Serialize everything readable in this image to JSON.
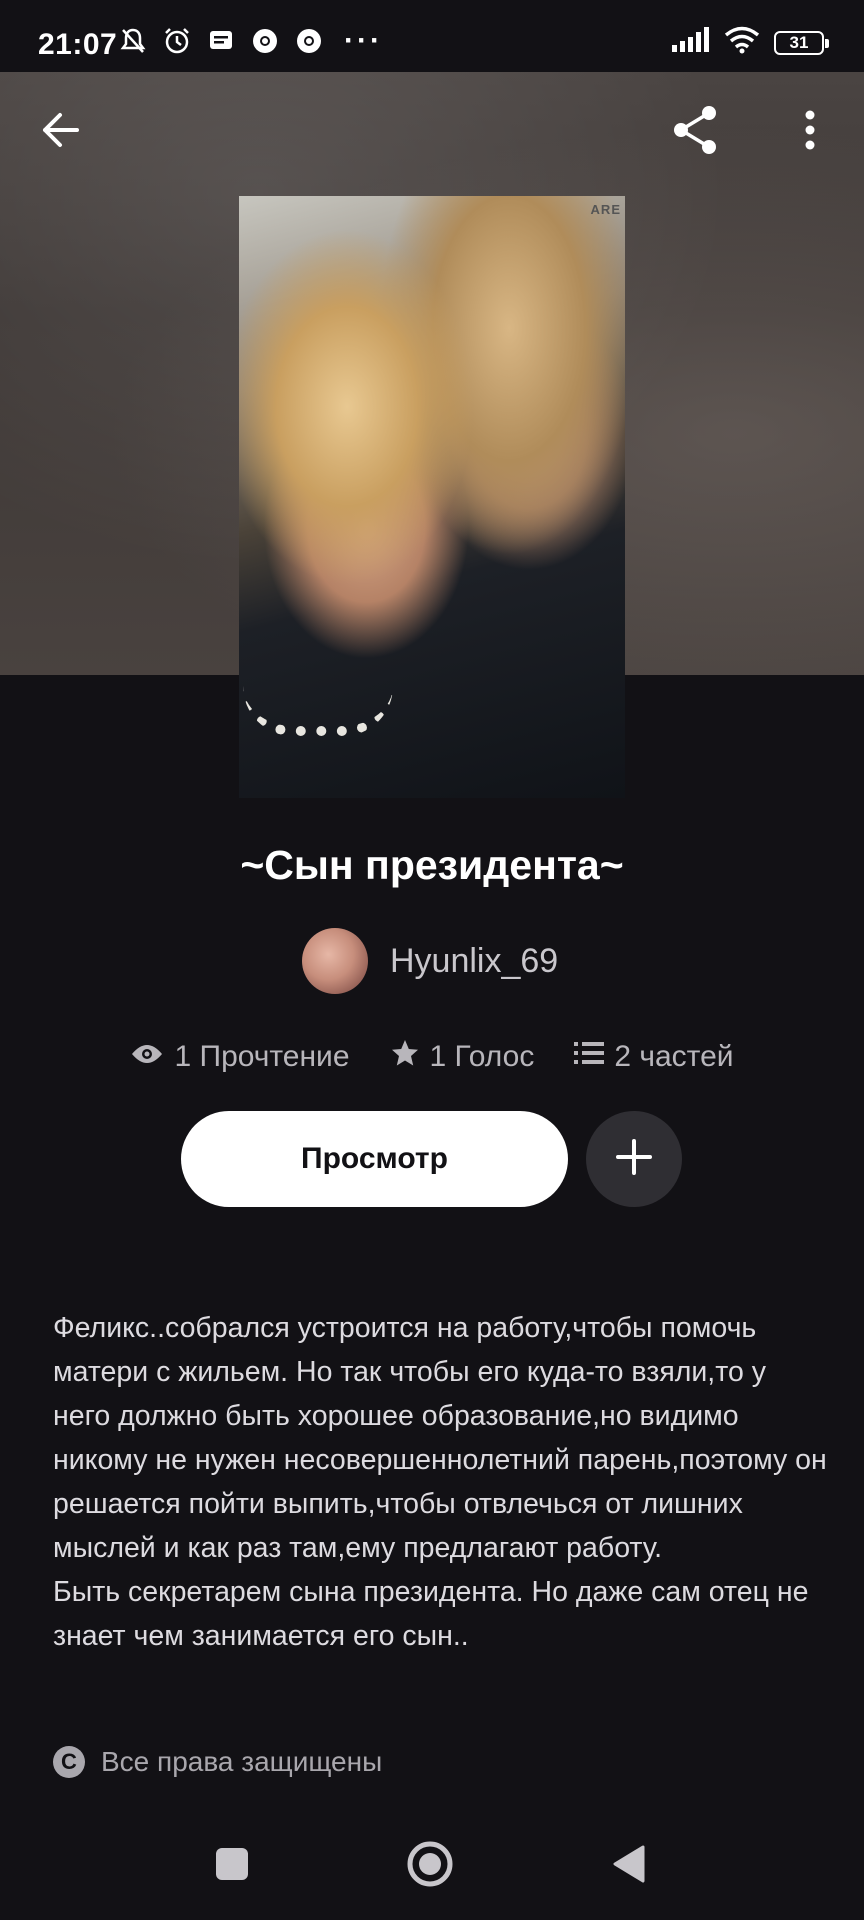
{
  "status_bar": {
    "time": "21:07",
    "icons": [
      "muted-bell-icon",
      "alarm-icon",
      "message-icon",
      "chrome-icon",
      "chrome-icon",
      "more-dots-icon",
      "signal-icon",
      "wifi-icon",
      "battery-icon"
    ],
    "more": "···",
    "battery": "31"
  },
  "header": {
    "back_icon": "arrow-left-icon",
    "share_icon": "share-icon",
    "more_icon": "more-vertical-icon"
  },
  "cover": {
    "mark": "ARE"
  },
  "story": {
    "title": "~Сын президента~",
    "author": "Hyunlix_69",
    "stats": {
      "reads": "1 Прочтение",
      "votes": "1 Голос",
      "parts": "2 частей"
    },
    "read_button": "Просмотр",
    "add_icon": "plus-icon",
    "description": "Феликс..собрался устроится на работу,чтобы помочь матери с жильем. Но так чтобы его куда-то взяли,то у него должно быть хорошее образование,но видимо никому не нужен несовершеннолетний парень,поэтому он решается пойти выпить,чтобы отвлечься от лишних мыслей и как раз там,ему предлагают работу.\nБыть секретарем сына президента. Но даже сам отец не знает чем занимается его сын..",
    "rights": "Все права защищены",
    "rights_icon": "copyright-icon"
  },
  "nav_bar": [
    "square-icon",
    "home-circle-icon",
    "back-triangle-icon"
  ],
  "colors": {
    "background": "#121115",
    "button": "#ffffff",
    "secondary": "#2f2e33"
  }
}
